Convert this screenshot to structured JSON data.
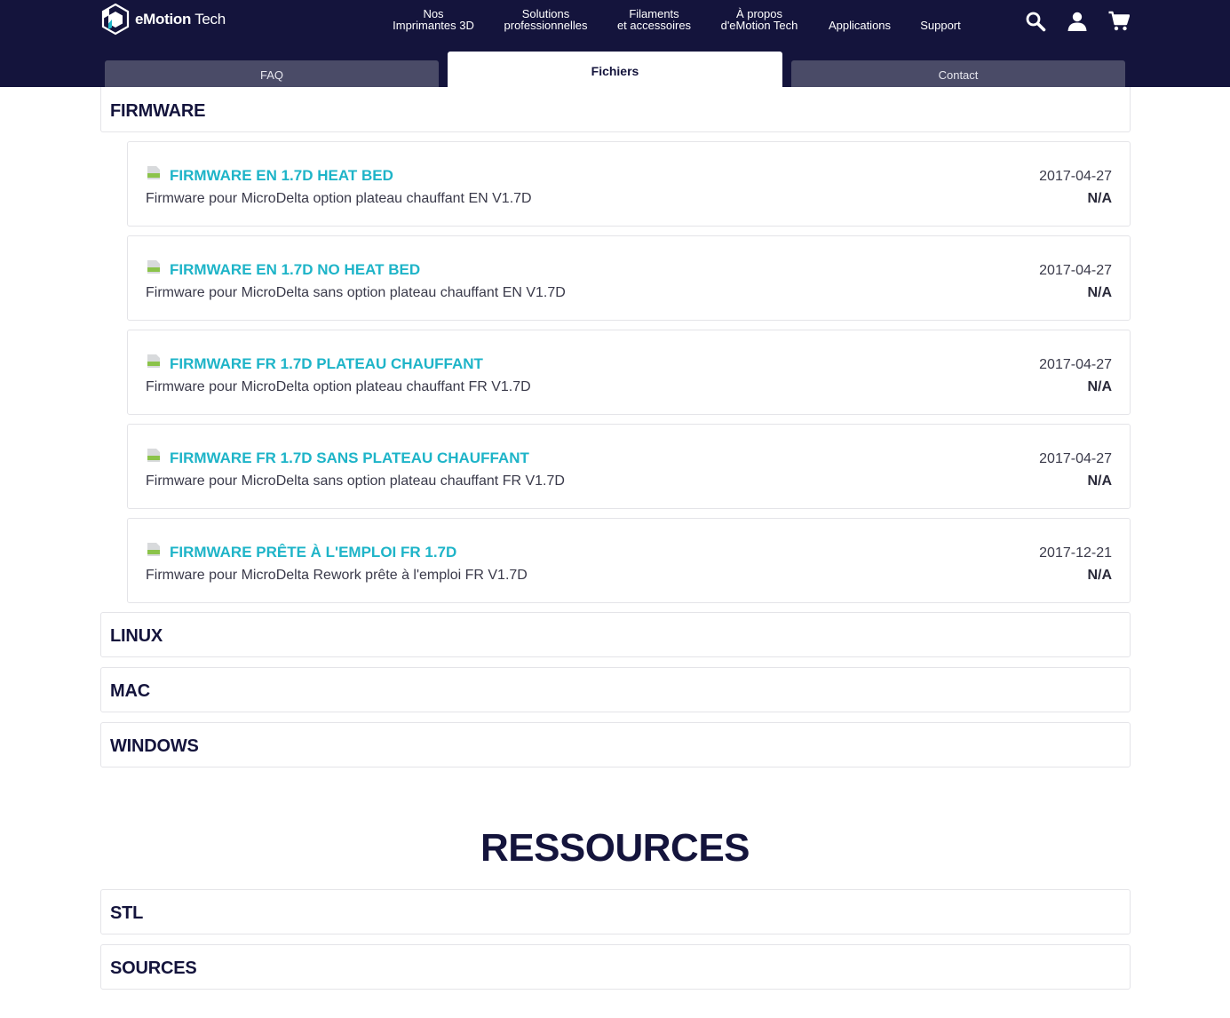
{
  "brand": {
    "name_bold": "eMotion",
    "name_light": "Tech"
  },
  "nav": [
    {
      "line1": "Nos",
      "line2": "Imprimantes 3D"
    },
    {
      "line1": "Solutions",
      "line2": "professionnelles"
    },
    {
      "line1": "Filaments",
      "line2": "et accessoires"
    },
    {
      "line1": "À propos",
      "line2": "d'eMotion Tech"
    },
    {
      "line1": "Applications"
    },
    {
      "line1": "Support"
    }
  ],
  "tabs": {
    "faq": "FAQ",
    "files": "Fichiers",
    "contact": "Contact"
  },
  "sections": {
    "firmware": "FIRMWARE",
    "linux": "LINUX",
    "mac": "MAC",
    "windows": "WINDOWS",
    "stl": "STL",
    "sources": "SOURCES"
  },
  "files": [
    {
      "title": "FIRMWARE EN 1.7D HEAT BED",
      "description": "Firmware pour MicroDelta option plateau chauffant EN V1.7D",
      "date": "2017-04-27",
      "size": "N/A"
    },
    {
      "title": "FIRMWARE EN 1.7D NO HEAT BED",
      "description": "Firmware pour MicroDelta sans option plateau chauffant EN V1.7D",
      "date": "2017-04-27",
      "size": "N/A"
    },
    {
      "title": "FIRMWARE FR 1.7D PLATEAU CHAUFFANT",
      "description": "Firmware pour MicroDelta option plateau chauffant FR V1.7D",
      "date": "2017-04-27",
      "size": "N/A"
    },
    {
      "title": "FIRMWARE FR 1.7D SANS PLATEAU CHAUFFANT",
      "description": "Firmware pour MicroDelta sans option plateau chauffant FR V1.7D",
      "date": "2017-04-27",
      "size": "N/A"
    },
    {
      "title": "FIRMWARE PRÊTE À L'EMPLOI FR 1.7D",
      "description": "Firmware pour MicroDelta Rework prête à l'emploi FR V1.7D",
      "date": "2017-12-21",
      "size": "N/A"
    }
  ],
  "resources_heading": "RESSOURCES",
  "colors": {
    "header_bg": "#14143c",
    "accent": "#1eb4c8",
    "tab_inactive": "#4a4b67"
  }
}
